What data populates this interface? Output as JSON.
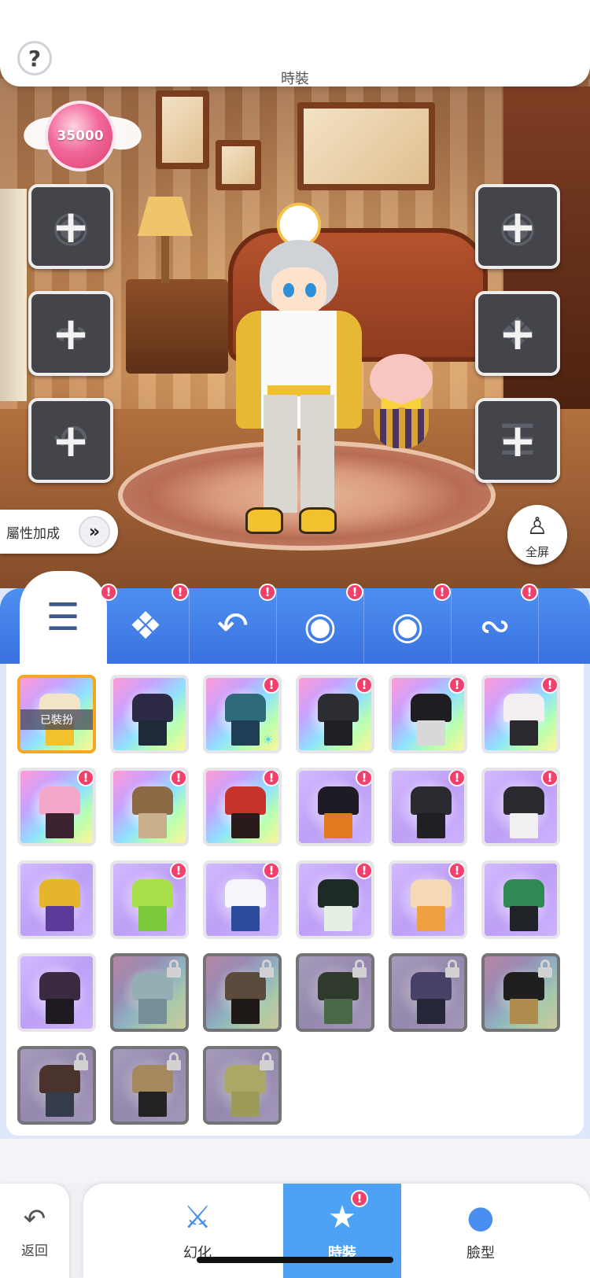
{
  "header": {
    "title": "時裝",
    "help_icon": "question-mark-icon",
    "help_label": "?"
  },
  "currency": {
    "value": "35000"
  },
  "slots": {
    "left": [
      {
        "name": "hat",
        "icon": "hat-icon"
      },
      {
        "name": "mustache",
        "icon": "mustache-icon"
      },
      {
        "name": "tail",
        "icon": "tail-icon"
      }
    ],
    "right": [
      {
        "name": "mask",
        "icon": "mask-icon"
      },
      {
        "name": "wings",
        "icon": "wings-icon"
      },
      {
        "name": "outfit",
        "icon": "jacket-icon"
      }
    ]
  },
  "attribute_button": {
    "label": "屬性加成",
    "arrow": "»"
  },
  "fullscreen_button": {
    "label": "全屏"
  },
  "categories": [
    {
      "name": "outfit",
      "icon": "jacket-icon",
      "badge": "!",
      "active": true
    },
    {
      "name": "wings",
      "icon": "wings-icon",
      "badge": "!"
    },
    {
      "name": "tail",
      "icon": "tail-icon",
      "badge": "!"
    },
    {
      "name": "hat",
      "icon": "hat-icon",
      "badge": "!"
    },
    {
      "name": "mask",
      "icon": "mask-icon",
      "badge": "!"
    },
    {
      "name": "mustache",
      "icon": "mustache-icon",
      "badge": "!"
    }
  ],
  "grid": {
    "equipped_label": "已裝扮",
    "items": [
      {
        "bg": "rainbow",
        "equipped": true,
        "top": "#f3e3c7",
        "bottom": "#f2c12e"
      },
      {
        "bg": "rainbow",
        "top": "#2d2a45",
        "bottom": "#1e2a3a"
      },
      {
        "bg": "rainbow",
        "badge": "!",
        "top": "#2e6a7a",
        "bottom": "#1f3d55",
        "hint": true
      },
      {
        "bg": "rainbow",
        "badge": "!",
        "top": "#2c2c33",
        "bottom": "#1f1f25"
      },
      {
        "bg": "rainbow",
        "badge": "!",
        "top": "#1d1d22",
        "bottom": "#d8d8d8"
      },
      {
        "bg": "rainbow",
        "badge": "!",
        "top": "#f3eef0",
        "bottom": "#2a2a30"
      },
      {
        "bg": "rainbow",
        "badge": "!",
        "top": "#f3a7c9",
        "bottom": "#3a2230"
      },
      {
        "bg": "rainbow",
        "badge": "!",
        "top": "#8b6a45",
        "bottom": "#c9b08c"
      },
      {
        "bg": "rainbow",
        "badge": "!",
        "top": "#c7322b",
        "bottom": "#2a1b1b"
      },
      {
        "bg": "purple",
        "badge": "!",
        "top": "#1f1b26",
        "bottom": "#e07a1f"
      },
      {
        "bg": "purple",
        "badge": "!",
        "top": "#2a2a30",
        "bottom": "#202025"
      },
      {
        "bg": "purple",
        "badge": "!",
        "top": "#2a2a30",
        "bottom": "#f0f0f0"
      },
      {
        "bg": "purple",
        "top": "#e7b52c",
        "bottom": "#5b3a9a"
      },
      {
        "bg": "purple",
        "badge": "!",
        "top": "#a9e04a",
        "bottom": "#7ac93b"
      },
      {
        "bg": "purple",
        "badge": "!",
        "top": "#f4f6fb",
        "bottom": "#2a4b9c"
      },
      {
        "bg": "purple",
        "badge": "!",
        "top": "#1e2b24",
        "bottom": "#e4f0e2"
      },
      {
        "bg": "purple",
        "badge": "!",
        "top": "#f4d9b4",
        "bottom": "#f0a040"
      },
      {
        "bg": "purple",
        "top": "#2e8a52",
        "bottom": "#1f2328"
      },
      {
        "bg": "purple",
        "top": "#3a2b42",
        "bottom": "#1f1a22"
      },
      {
        "bg": "rainbow",
        "locked": true,
        "top": "#a2d9e6",
        "bottom": "#79b3c9"
      },
      {
        "bg": "rainbow",
        "locked": true,
        "top": "#7a5a3a",
        "bottom": "#2a1f1a"
      },
      {
        "bg": "purple",
        "locked": true,
        "top": "#2f4a2a",
        "bottom": "#3f8a3a"
      },
      {
        "bg": "purple",
        "locked": true,
        "top": "#5a4aa0",
        "bottom": "#2a2f55"
      },
      {
        "bg": "rainbow",
        "locked": true,
        "top": "#2a2620",
        "bottom": "#f2a81e"
      },
      {
        "bg": "purple",
        "locked": true,
        "top": "#6b3a2a",
        "bottom": "#3a4a6a"
      },
      {
        "bg": "purple",
        "locked": true,
        "top": "#e6a245",
        "bottom": "#2a2a2a"
      },
      {
        "bg": "purple",
        "locked": true,
        "top": "#d8d040",
        "bottom": "#c8c030"
      }
    ]
  },
  "bottom_nav": {
    "back_label": "返回",
    "items": [
      {
        "label": "幻化",
        "icon": "sword-icon"
      },
      {
        "label": "時裝",
        "icon": "outfit-icon",
        "badge": "!",
        "active": true
      },
      {
        "label": "臉型",
        "icon": "face-icon"
      }
    ]
  },
  "colors": {
    "accent_blue": "#3a72e0",
    "badge_red": "#f0406b",
    "equipped_orange": "#f5a623",
    "currency_pink": "#f2679a"
  }
}
